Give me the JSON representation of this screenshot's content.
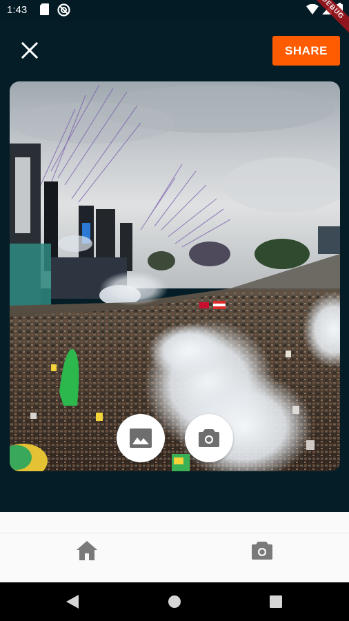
{
  "status_bar": {
    "time": "1:43",
    "icons": [
      "sd-card-icon",
      "do-not-disturb-icon",
      "wifi-icon",
      "cell-signal-icon",
      "battery-icon"
    ]
  },
  "debug_banner": {
    "label": "DEBUG"
  },
  "app_bar": {
    "close_icon": "close-icon",
    "share_label": "SHARE"
  },
  "photo": {
    "description_icon": "photo-preview",
    "actions": [
      {
        "name": "gallery",
        "icon": "image-icon"
      },
      {
        "name": "camera",
        "icon": "camera-icon"
      }
    ]
  },
  "bottom_nav": {
    "items": [
      {
        "name": "home",
        "icon": "home-icon"
      },
      {
        "name": "camera",
        "icon": "camera-icon"
      }
    ]
  },
  "system_nav": {
    "buttons": [
      "back-icon",
      "home-circle-icon",
      "recents-icon"
    ]
  },
  "colors": {
    "background": "#051d27",
    "accent": "#ff5b00",
    "icon_grey": "#7a7a7a",
    "white": "#ffffff"
  }
}
